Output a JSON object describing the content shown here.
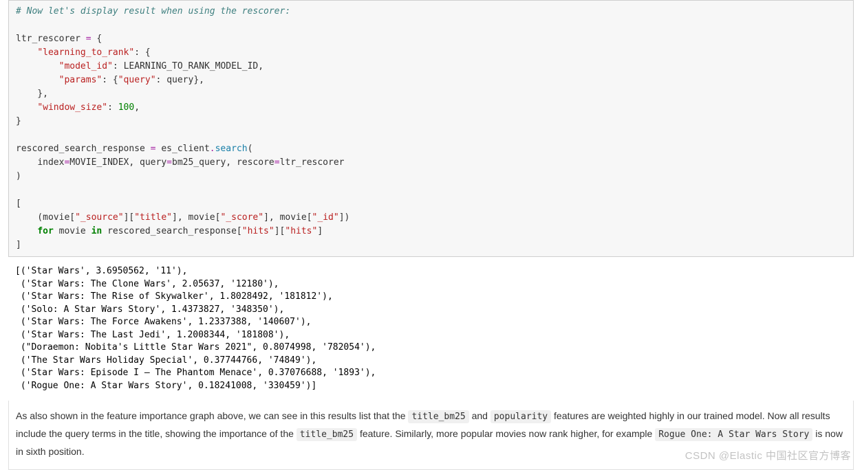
{
  "code": {
    "comment": "# Now let's display result when using the rescorer:",
    "v_ltr": "ltr_rescorer",
    "k_learning": "\"learning_to_rank\"",
    "k_model_id": "\"model_id\"",
    "v_model_id": "LEARNING_TO_RANK_MODEL_ID",
    "k_params": "\"params\"",
    "k_query": "\"query\"",
    "v_query": "query",
    "k_window": "\"window_size\"",
    "v_window": "100",
    "v_resp": "rescored_search_response",
    "v_client": "es_client",
    "m_search": "search",
    "kw_index": "index",
    "v_index": "MOVIE_INDEX",
    "kw_query": "query",
    "v_bm25": "bm25_query",
    "kw_rescore": "rescore",
    "v_rescore": "ltr_rescorer",
    "v_movie": "movie",
    "s_source": "\"_source\"",
    "s_title": "\"title\"",
    "s_score": "\"_score\"",
    "s_id": "\"_id\"",
    "kw_for": "for",
    "kw_in": "in",
    "s_hits": "\"hits\""
  },
  "output": {
    "lines": [
      "[('Star Wars', 3.6950562, '11'),",
      " ('Star Wars: The Clone Wars', 2.05637, '12180'),",
      " ('Star Wars: The Rise of Skywalker', 1.8028492, '181812'),",
      " ('Solo: A Star Wars Story', 1.4373827, '348350'),",
      " ('Star Wars: The Force Awakens', 1.2337388, '140607'),",
      " ('Star Wars: The Last Jedi', 1.2008344, '181808'),",
      " (\"Doraemon: Nobita's Little Star Wars 2021\", 0.8074998, '782054'),",
      " ('The Star Wars Holiday Special', 0.37744766, '74849'),",
      " ('Star Wars: Episode I – The Phantom Menace', 0.37076688, '1893'),",
      " ('Rogue One: A Star Wars Story', 0.18241008, '330459')]"
    ]
  },
  "md": {
    "t1": "As also shown in the feature importance graph above, we can see in this results list that the ",
    "code1": "title_bm25",
    "t2": " and ",
    "code2": "popularity",
    "t3": " features are weighted highly in our trained model. Now all results include the query terms in the title, showing the importance of the ",
    "code3": "title_bm25",
    "t4": " feature. Similarly, more popular movies now rank higher, for example ",
    "code4": "Rogue One: A Star Wars Story",
    "t5": " is now in sixth position."
  },
  "watermark": "CSDN @Elastic 中国社区官方博客"
}
